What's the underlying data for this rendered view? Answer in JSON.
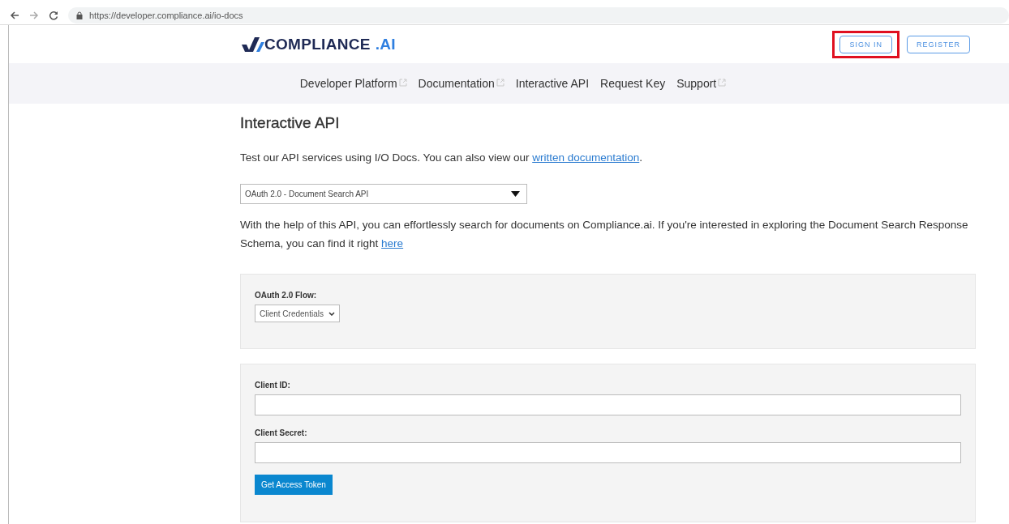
{
  "browser": {
    "url": "https://developer.compliance.ai/io-docs"
  },
  "header": {
    "logo_text": "COMPLIANCE",
    "logo_suffix": ".AI",
    "buttons": [
      {
        "label": "SIGN IN",
        "highlighted": true
      },
      {
        "label": "REGISTER",
        "highlighted": false
      }
    ]
  },
  "nav": [
    {
      "label": "Developer Platform",
      "external": true
    },
    {
      "label": "Documentation",
      "external": true
    },
    {
      "label": "Interactive API",
      "external": false
    },
    {
      "label": "Request Key",
      "external": false
    },
    {
      "label": "Support",
      "external": true
    }
  ],
  "page": {
    "title": "Interactive API",
    "intro": "Test our API services using I/O Docs. You can also view our ",
    "intro_link": "written documentation",
    "intro_end": ".",
    "api_select": "OAuth 2.0 - Document Search API",
    "description": "With the help of this API, you can effortlessly search for documents on Compliance.ai. If you're interested in exploring the Document Search Response Schema, you can find it right ",
    "description_link": "here"
  },
  "flow_panel": {
    "label": "OAuth 2.0 Flow:",
    "select": "Client Credentials"
  },
  "credentials_panel": {
    "fields": [
      {
        "label": "Client ID:"
      },
      {
        "label": "Client Secret:"
      }
    ],
    "button": "Get Access Token"
  }
}
